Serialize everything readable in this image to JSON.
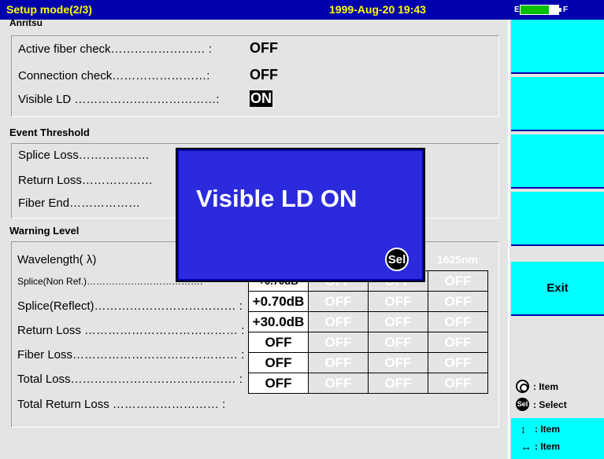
{
  "title": {
    "mode": "Setup mode(2/3)",
    "datetime": "1999-Aug-20 19:43"
  },
  "battery": {
    "empty_label": "E",
    "full_label": "F",
    "level": 0.75
  },
  "anritsu": {
    "heading": "Anritsu",
    "rows": [
      {
        "label": "Active fiber check…………………… :",
        "value": "OFF"
      },
      {
        "label": "Connection check……………………:",
        "value": "OFF"
      },
      {
        "label": "Visible LD ………………………………:",
        "value": "ON"
      }
    ]
  },
  "event_threshold": {
    "heading": "Event Threshold",
    "rows": [
      {
        "label": "Splice Loss………………"
      },
      {
        "label": "Return Loss………………"
      },
      {
        "label": "Fiber End………………"
      }
    ]
  },
  "warning_level": {
    "heading": "Warning Level",
    "wavelength_label": "Wavelength( λ)",
    "wavelength_cols": [
      "",
      "",
      "",
      "1625nm"
    ],
    "rows": [
      {
        "label": "Splice(Non Ref.)………………………………:",
        "cells": [
          "+0.70dB",
          "OFF",
          "OFF",
          "OFF"
        ]
      },
      {
        "label": "Splice(Reflect)……………………………… :",
        "cells": [
          "+0.70dB",
          "OFF",
          "OFF",
          "OFF"
        ]
      },
      {
        "label": "Return Loss ………………………………… :",
        "cells": [
          "+30.0dB",
          "OFF",
          "OFF",
          "OFF"
        ]
      },
      {
        "label": "Fiber Loss…………………………………… :",
        "cells": [
          "OFF",
          "OFF",
          "OFF",
          "OFF"
        ]
      },
      {
        "label": "Total Loss…………………………………… :",
        "cells": [
          "OFF",
          "OFF",
          "OFF",
          "OFF"
        ]
      },
      {
        "label": "Total Return Loss ……………………… :",
        "cells": [
          "OFF",
          "OFF",
          "OFF",
          "OFF"
        ]
      }
    ]
  },
  "function_keys": [
    "",
    "",
    "",
    "",
    "Exit"
  ],
  "guides": {
    "item": ": Item",
    "select": ": Select",
    "sel_glyph": "Sel",
    "updown": ": Item",
    "leftright": ": Item"
  },
  "popup": {
    "message": "Visible LD ON",
    "sel_button": "Sel"
  }
}
